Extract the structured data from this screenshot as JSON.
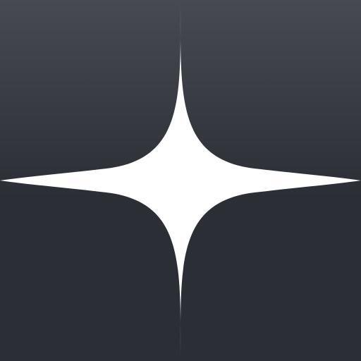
{
  "icon": {
    "name": "four-point-sparkle-star-icon",
    "colors": {
      "background_top": "#474a51",
      "background_bottom": "#2b2e35",
      "star": "#ffffff"
    }
  }
}
